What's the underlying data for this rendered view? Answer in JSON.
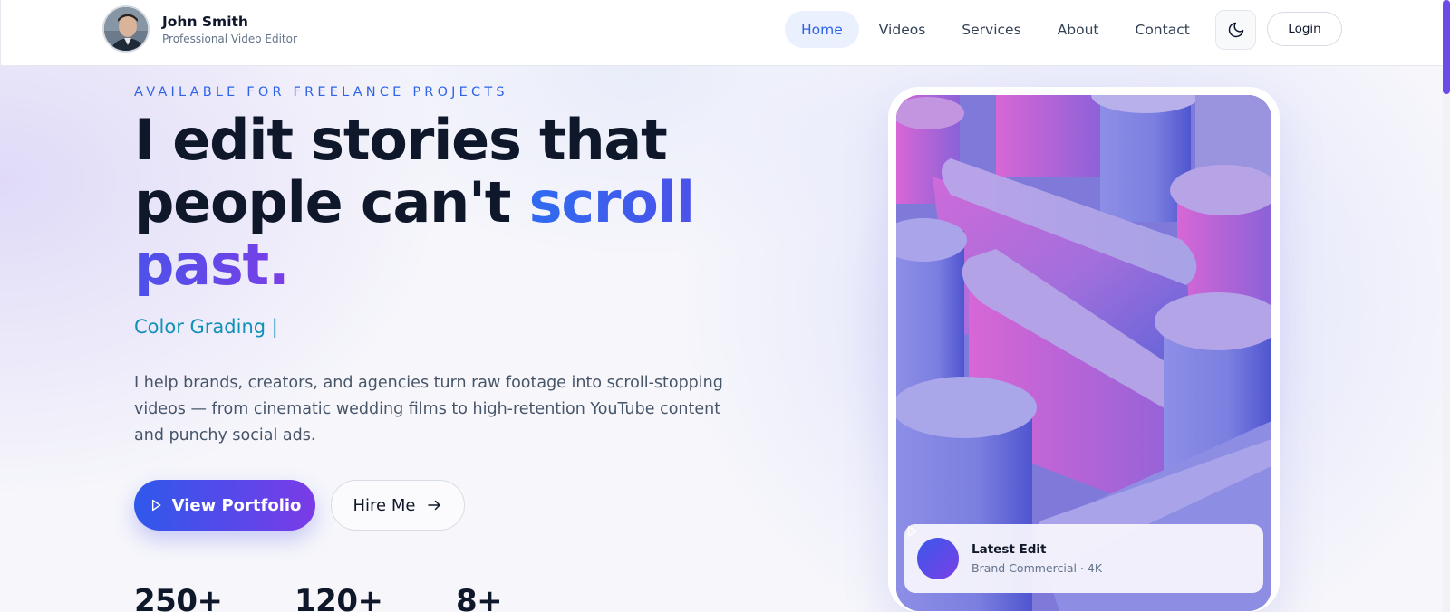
{
  "brand": {
    "name": "John Smith",
    "role": "Professional Video Editor"
  },
  "nav": {
    "items": [
      {
        "label": "Home",
        "active": true
      },
      {
        "label": "Videos",
        "active": false
      },
      {
        "label": "Services",
        "active": false
      },
      {
        "label": "About",
        "active": false
      },
      {
        "label": "Contact",
        "active": false
      }
    ],
    "theme_toggle_icon": "moon-icon",
    "login_label": "Login"
  },
  "hero": {
    "eyebrow": "AVAILABLE FOR FREELANCE PROJECTS",
    "headline_part1": "I edit stories that people can't ",
    "headline_accent": "scroll past.",
    "typing_text": "Color Grading |",
    "description": "I help brands, creators, and agencies turn raw footage into scroll-stopping videos — from cinematic wedding films to high-retention YouTube content and punchy social ads.",
    "primary_cta": "View Portfolio",
    "secondary_cta": "Hire Me"
  },
  "stats": [
    {
      "value": "250+"
    },
    {
      "value": "120+"
    },
    {
      "value": "8+"
    }
  ],
  "showcase": {
    "card_title": "Latest Edit",
    "card_subtitle": "Brand Commercial · 4K"
  },
  "colors": {
    "accent_blue": "#2f63e8",
    "accent_purple": "#7b3be6",
    "typing_teal": "#1190b8",
    "nav_active_bg": "#eaf0fd"
  }
}
